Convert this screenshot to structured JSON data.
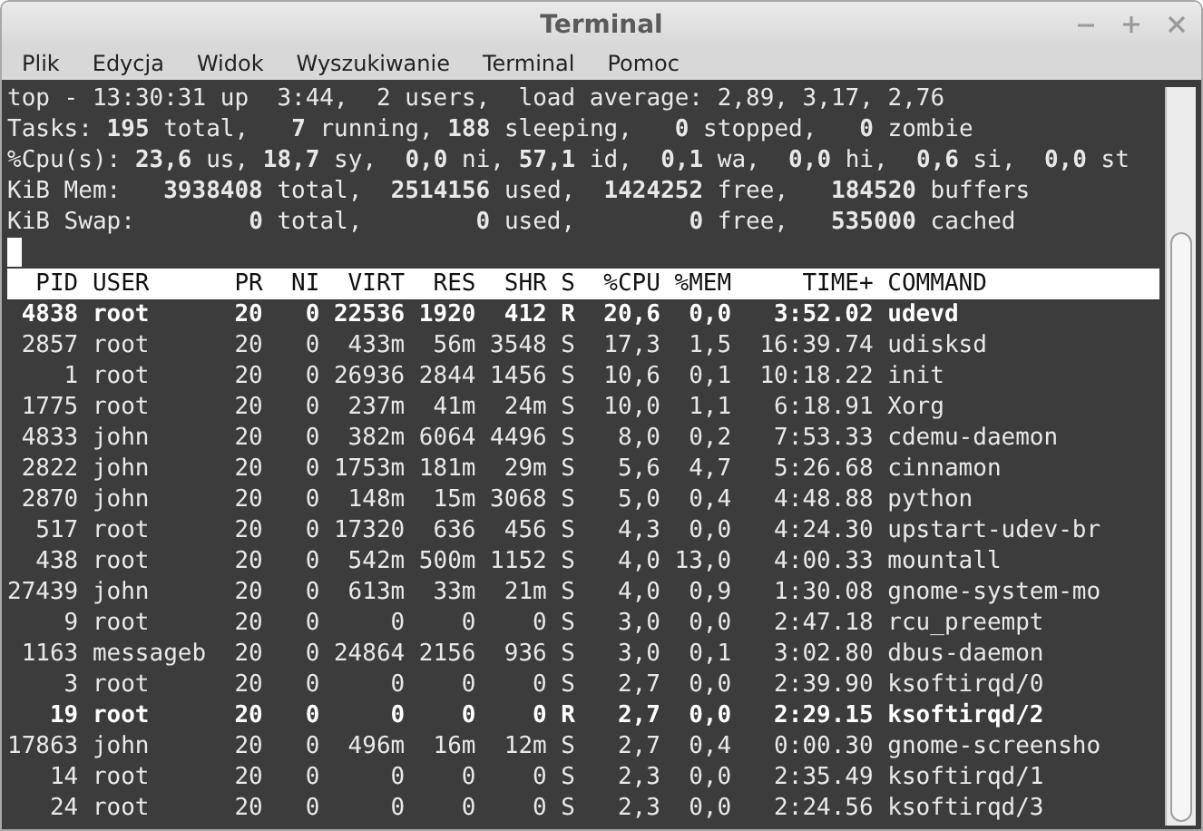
{
  "window": {
    "title": "Terminal"
  },
  "menu": [
    "Plik",
    "Edycja",
    "Widok",
    "Wyszukiwanie",
    "Terminal",
    "Pomoc"
  ],
  "summary_lines": [
    "top - 13:30:31 up  3:44,  2 users,  load average: 2,89, 3,17, 2,76",
    "Tasks: **195** total,   **7** running, **188** sleeping,   **0** stopped,   **0** zombie",
    "%Cpu(s): **23,6** us, **18,7** sy,  **0,0** ni, **57,1** id,  **0,1** wa,  **0,0** hi,  **0,6** si,  **0,0** st",
    "KiB Mem:   **3938408** total,  **2514156** used,  **1424252** free,   **184520** buffers",
    "KiB Swap:        **0** total,        **0** used,        **0** free,   **535000** cached"
  ],
  "columns": [
    "PID",
    "USER",
    "PR",
    "NI",
    "VIRT",
    "RES",
    "SHR",
    "S",
    "%CPU",
    "%MEM",
    "TIME+",
    "COMMAND"
  ],
  "rows": [
    {
      "cells": [
        "4838",
        "root",
        "20",
        "0",
        "22536",
        "1920",
        "412",
        "R",
        "20,6",
        "0,0",
        "3:52.02",
        "udevd"
      ],
      "highlighted": true
    },
    {
      "cells": [
        "2857",
        "root",
        "20",
        "0",
        "433m",
        "56m",
        "3548",
        "S",
        "17,3",
        "1,5",
        "16:39.74",
        "udisksd"
      ],
      "highlighted": false
    },
    {
      "cells": [
        "1",
        "root",
        "20",
        "0",
        "26936",
        "2844",
        "1456",
        "S",
        "10,6",
        "0,1",
        "10:18.22",
        "init"
      ],
      "highlighted": false
    },
    {
      "cells": [
        "1775",
        "root",
        "20",
        "0",
        "237m",
        "41m",
        "24m",
        "S",
        "10,0",
        "1,1",
        "6:18.91",
        "Xorg"
      ],
      "highlighted": false
    },
    {
      "cells": [
        "4833",
        "john",
        "20",
        "0",
        "382m",
        "6064",
        "4496",
        "S",
        "8,0",
        "0,2",
        "7:53.33",
        "cdemu-daemon"
      ],
      "highlighted": false
    },
    {
      "cells": [
        "2822",
        "john",
        "20",
        "0",
        "1753m",
        "181m",
        "29m",
        "S",
        "5,6",
        "4,7",
        "5:26.68",
        "cinnamon"
      ],
      "highlighted": false
    },
    {
      "cells": [
        "2870",
        "john",
        "20",
        "0",
        "148m",
        "15m",
        "3068",
        "S",
        "5,0",
        "0,4",
        "4:48.88",
        "python"
      ],
      "highlighted": false
    },
    {
      "cells": [
        "517",
        "root",
        "20",
        "0",
        "17320",
        "636",
        "456",
        "S",
        "4,3",
        "0,0",
        "4:24.30",
        "upstart-udev-br"
      ],
      "highlighted": false
    },
    {
      "cells": [
        "438",
        "root",
        "20",
        "0",
        "542m",
        "500m",
        "1152",
        "S",
        "4,0",
        "13,0",
        "4:00.33",
        "mountall"
      ],
      "highlighted": false
    },
    {
      "cells": [
        "27439",
        "john",
        "20",
        "0",
        "613m",
        "33m",
        "21m",
        "S",
        "4,0",
        "0,9",
        "1:30.08",
        "gnome-system-mo"
      ],
      "highlighted": false
    },
    {
      "cells": [
        "9",
        "root",
        "20",
        "0",
        "0",
        "0",
        "0",
        "S",
        "3,0",
        "0,0",
        "2:47.18",
        "rcu_preempt"
      ],
      "highlighted": false
    },
    {
      "cells": [
        "1163",
        "messageb",
        "20",
        "0",
        "24864",
        "2156",
        "936",
        "S",
        "3,0",
        "0,1",
        "3:02.80",
        "dbus-daemon"
      ],
      "highlighted": false
    },
    {
      "cells": [
        "3",
        "root",
        "20",
        "0",
        "0",
        "0",
        "0",
        "S",
        "2,7",
        "0,0",
        "2:39.90",
        "ksoftirqd/0"
      ],
      "highlighted": false
    },
    {
      "cells": [
        "19",
        "root",
        "20",
        "0",
        "0",
        "0",
        "0",
        "R",
        "2,7",
        "0,0",
        "2:29.15",
        "ksoftirqd/2"
      ],
      "highlighted": true
    },
    {
      "cells": [
        "17863",
        "john",
        "20",
        "0",
        "496m",
        "16m",
        "12m",
        "S",
        "2,7",
        "0,4",
        "0:00.30",
        "gnome-screensho"
      ],
      "highlighted": false
    },
    {
      "cells": [
        "14",
        "root",
        "20",
        "0",
        "0",
        "0",
        "0",
        "S",
        "2,3",
        "0,0",
        "2:35.49",
        "ksoftirqd/1"
      ],
      "highlighted": false
    },
    {
      "cells": [
        "24",
        "root",
        "20",
        "0",
        "0",
        "0",
        "0",
        "S",
        "2,3",
        "0,0",
        "2:24.56",
        "ksoftirqd/3"
      ],
      "highlighted": false
    }
  ]
}
